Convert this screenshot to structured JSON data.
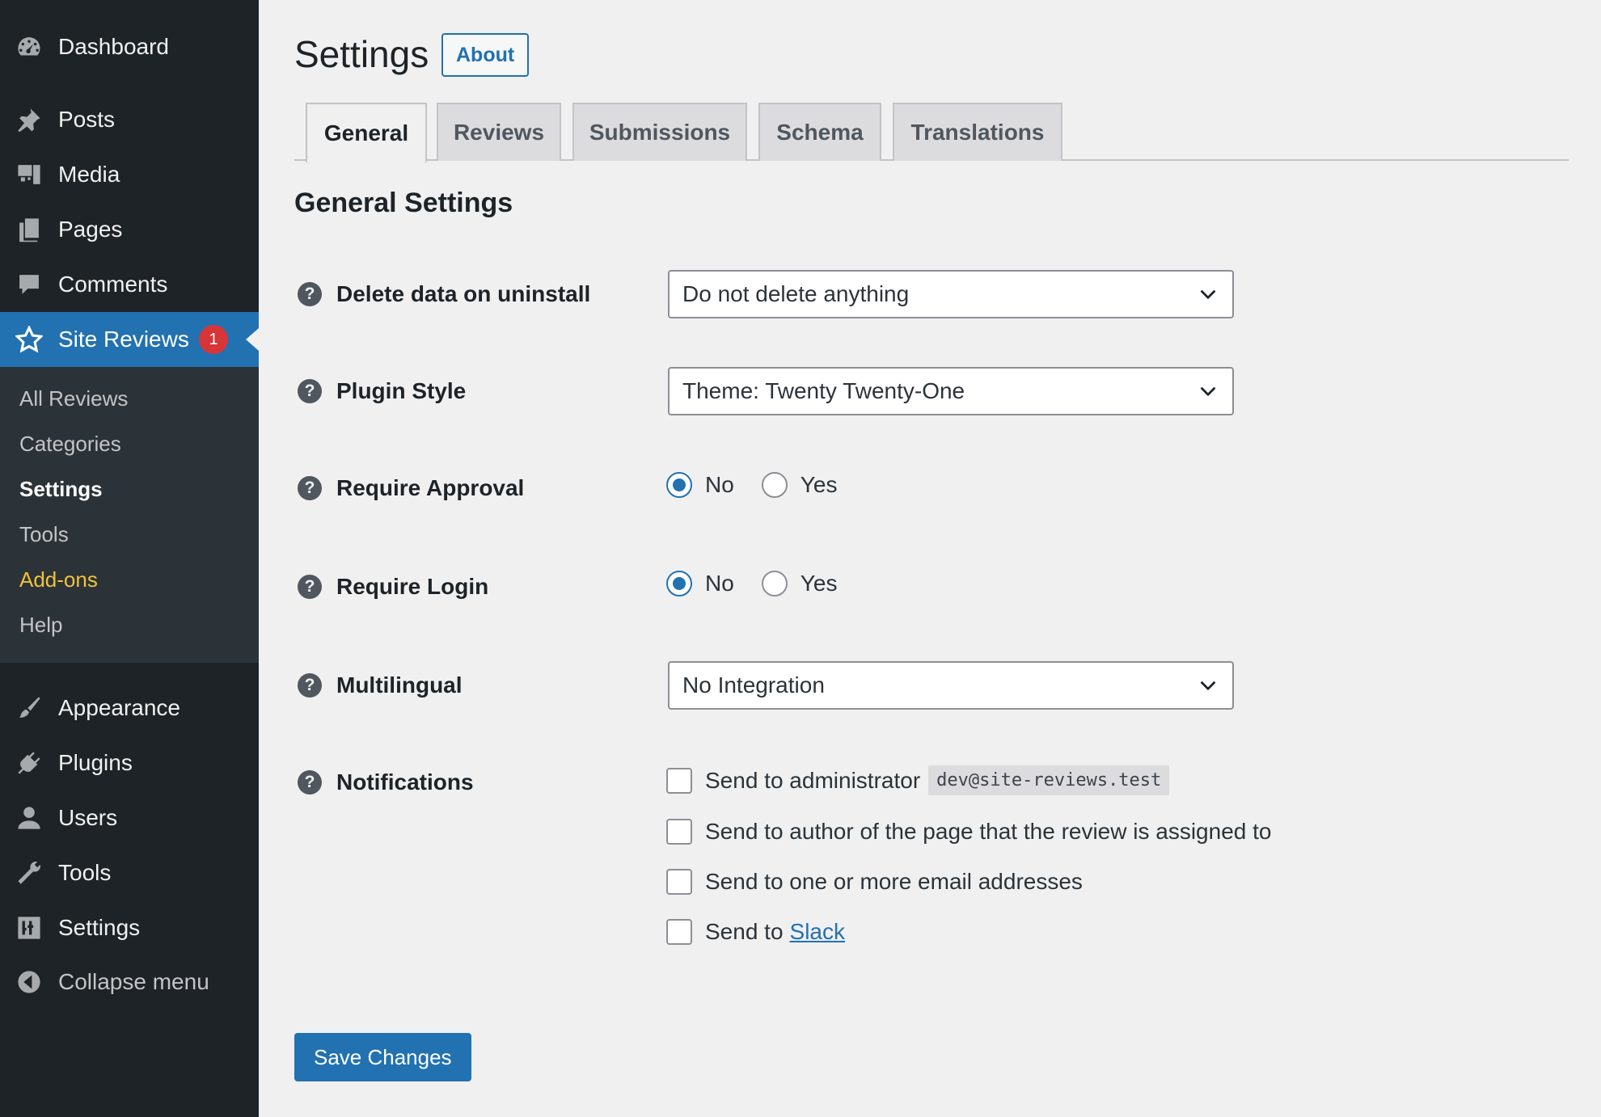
{
  "sidebar": {
    "items": [
      {
        "label": "Dashboard",
        "icon": "dashboard-icon"
      },
      {
        "label": "Posts",
        "icon": "pin-icon"
      },
      {
        "label": "Media",
        "icon": "media-icon"
      },
      {
        "label": "Pages",
        "icon": "pages-icon"
      },
      {
        "label": "Comments",
        "icon": "comment-icon"
      },
      {
        "label": "Site Reviews",
        "icon": "star-icon",
        "badge": "1"
      },
      {
        "label": "Appearance",
        "icon": "brush-icon"
      },
      {
        "label": "Plugins",
        "icon": "plug-icon"
      },
      {
        "label": "Users",
        "icon": "user-icon"
      },
      {
        "label": "Tools",
        "icon": "wrench-icon"
      },
      {
        "label": "Settings",
        "icon": "sliders-icon"
      },
      {
        "label": "Collapse menu",
        "icon": "collapse-icon"
      }
    ],
    "submenu": [
      "All Reviews",
      "Categories",
      "Settings",
      "Tools",
      "Add-ons",
      "Help"
    ]
  },
  "header": {
    "title": "Settings",
    "about_label": "About"
  },
  "tabs": [
    "General",
    "Reviews",
    "Submissions",
    "Schema",
    "Translations"
  ],
  "section_title": "General Settings",
  "fields": {
    "delete_data": {
      "label": "Delete data on uninstall",
      "value": "Do not delete anything"
    },
    "plugin_style": {
      "label": "Plugin Style",
      "value": "Theme: Twenty Twenty-One"
    },
    "require_approval": {
      "label": "Require Approval",
      "options": [
        "No",
        "Yes"
      ],
      "selected": "No"
    },
    "require_login": {
      "label": "Require Login",
      "options": [
        "No",
        "Yes"
      ],
      "selected": "No"
    },
    "multilingual": {
      "label": "Multilingual",
      "value": "No Integration"
    },
    "notifications": {
      "label": "Notifications",
      "admin": "Send to administrator",
      "admin_email": "dev@site-reviews.test",
      "author": "Send to author of the page that the review is assigned to",
      "emails": "Send to one or more email addresses",
      "slack_prefix": "Send to",
      "slack_link": "Slack"
    }
  },
  "help_glyph": "?",
  "save_label": "Save Changes",
  "colors": {
    "accent": "#2271b1",
    "sidebar": "#1d2327",
    "badge": "#d63638",
    "addons": "#f0c33c"
  }
}
